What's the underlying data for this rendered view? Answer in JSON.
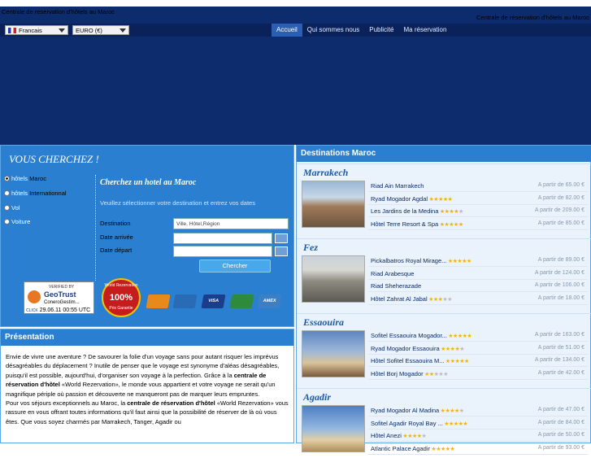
{
  "header": {
    "title_left": "Centrale de reservation d'hôtels au Maroc",
    "title_right": "Centrale de réservation d'hôtels au Maroc",
    "language": "Francais",
    "currency": "EURO (€)",
    "nav": [
      "Accueil",
      "Qui sommes nous",
      "Publicité",
      "Ma réservation"
    ]
  },
  "search": {
    "heading": "VOUS CHERCHEZ !",
    "options": [
      {
        "pre": "hôtels",
        "post": "Maroc",
        "checked": true
      },
      {
        "pre": "hôtels",
        "post": "Internationnal",
        "checked": false
      },
      {
        "pre": "Vol",
        "post": "",
        "checked": false
      },
      {
        "pre": "Voiture",
        "post": "",
        "checked": false
      }
    ],
    "subheading": "Cherchez un hotel au Maroc",
    "instructions": "Veuillez sélectionner votre destination et entrez vos dates",
    "destination_label": "Destination",
    "destination_placeholder": "Ville, Hôtel,Région",
    "arrival_label": "Date arrivée",
    "departure_label": "Date départ",
    "button": "Chercher"
  },
  "trust": {
    "verified": "VERIFIED BY",
    "brand": "GeoTrust",
    "company": "ConeroGestim...",
    "click": "CLICK",
    "date": "29.06.11 00:55 UTC",
    "seal_top": "World Rezervation",
    "seal_mid": "100%",
    "seal_bottom": "Prix Garantie"
  },
  "cards": [
    {
      "name": "MasterCard",
      "color": "#e8891c"
    },
    {
      "name": "CB",
      "color": "#2a6bb5"
    },
    {
      "name": "VISA",
      "color": "#1a3e8c"
    },
    {
      "name": "Visa Elec",
      "color": "#2e8b3c"
    },
    {
      "name": "AMEX",
      "color": "#3d7fc5"
    }
  ],
  "presentation": {
    "heading": "Présentation",
    "p1": "Envie de vivre une aventure ? De savourer la folie d'un voyage sans pour autant risquer les imprévus désagréables du déplacement ? Inutile de penser que le voyage est synonyme d'aléas désagréables, puisqu'il est possible, aujourd'hui, d'organiser son voyage à la perfection. Grâce à la",
    "p1_bold": "centrale de réservation d'hôtel",
    "p1_end": "«World Rezervation», le monde vous appartient et votre voyage ne serait qu'un magnifique périple où passion et découverte ne manqueront pas de marquer leurs empruntes.",
    "p2": "Pour vos séjours exceptionnels au Maroc, la",
    "p2_bold": "centrale de réservation d'hôtel",
    "p2_end": "«World Rezervation» vous rassure en vous offrant toutes informations qu'il faut ainsi que la possibilité de réserver de là où vous êtes. Que vous soyez charmés par Marrakech, Tanger, Agadir ou"
  },
  "destinations": {
    "heading": "Destinations Maroc",
    "cities": [
      {
        "name": "Marrakech",
        "hotels": [
          {
            "name": "Riad Ain Marrakech",
            "stars": 0,
            "price": "A partir de 65.00 €"
          },
          {
            "name": "Ryad Mogador Agdal",
            "stars": 5,
            "price": "A partir de 82.00 €"
          },
          {
            "name": "Les Jardins de la Medina",
            "stars": 4,
            "price": "A partir de 209.00 €"
          },
          {
            "name": "Hôtel Terre Resort & Spa",
            "stars": 5,
            "price": "A partir de 85.00 €"
          }
        ]
      },
      {
        "name": "Fez",
        "hotels": [
          {
            "name": "Pickalbatros Royal Mirage...",
            "stars": 5,
            "price": "A partir de 89.00 €"
          },
          {
            "name": "Riad Arabesque",
            "stars": 0,
            "price": "A partir de 124.00 €"
          },
          {
            "name": "Riad Sheherazade",
            "stars": 0,
            "price": "A partir de 106.00 €"
          },
          {
            "name": "Hôtel Zahrat Al Jabal",
            "stars": 3,
            "price": "A partir de 18.00 €"
          }
        ]
      },
      {
        "name": "Essaouira",
        "hotels": [
          {
            "name": "Sofitel Essaouira Mogador...",
            "stars": 5,
            "price": "A partir de 163.00 €"
          },
          {
            "name": "Ryad Mogador Essaouira",
            "stars": 4,
            "price": "A partir de 51.00 €"
          },
          {
            "name": "Hôtel Sofitel Essaouira M...",
            "stars": 5,
            "price": "A partir de 134.00 €"
          },
          {
            "name": "Hôtel Borj Mogador",
            "stars": 2,
            "price": "A partir de 42.00 €"
          }
        ]
      },
      {
        "name": "Agadir",
        "hotels": [
          {
            "name": "Ryad Mogador Al Madina",
            "stars": 4,
            "price": "A partir de 47.00 €"
          },
          {
            "name": "Sofitel Agadir Royal Bay ...",
            "stars": 5,
            "price": "A partir de 84.00 €"
          },
          {
            "name": "Hôtel Anezi",
            "stars": 4,
            "price": "A partir de 50.00 €"
          },
          {
            "name": "Atlantic Palace Agadir",
            "stars": 5,
            "price": "A partir de 93.00 €"
          }
        ]
      }
    ]
  }
}
